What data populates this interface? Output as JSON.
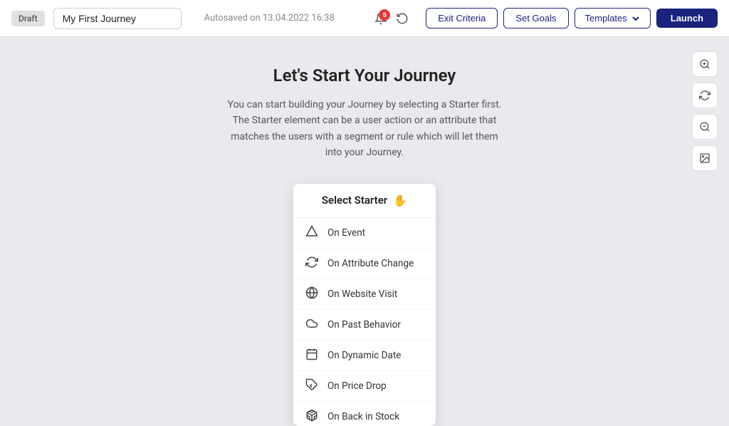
{
  "header": {
    "draft_label": "Draft",
    "journey_name": "My First Journey",
    "autosave_text": "Autosaved on 13.04.2022 16:38",
    "notif_count": "5",
    "exit_criteria_label": "Exit Criteria",
    "set_goals_label": "Set Goals",
    "templates_label": "Templates",
    "launch_label": "Launch"
  },
  "canvas": {
    "title": "Let's Start Your Journey",
    "description": "You can start building your Journey by selecting a Starter first. The Starter element can be a user action or an attribute that matches the users with a segment or rule which will let them into your Journey."
  },
  "starter": {
    "header_label": "Select Starter",
    "items": [
      {
        "id": "on-event",
        "label": "On Event",
        "icon": "triangle"
      },
      {
        "id": "on-attribute-change",
        "label": "On Attribute Change",
        "icon": "refresh"
      },
      {
        "id": "on-website-visit",
        "label": "On Website Visit",
        "icon": "globe"
      },
      {
        "id": "on-past-behavior",
        "label": "On Past Behavior",
        "icon": "cloud"
      },
      {
        "id": "on-dynamic-date",
        "label": "On Dynamic Date",
        "icon": "calendar"
      },
      {
        "id": "on-price-drop",
        "label": "On Price Drop",
        "icon": "tag"
      },
      {
        "id": "on-back-in-stock",
        "label": "On Back in Stock",
        "icon": "box"
      }
    ]
  },
  "toolbar": {
    "zoom_in_icon": "zoom-in",
    "refresh_icon": "refresh",
    "zoom_out_icon": "zoom-out",
    "image_icon": "image"
  }
}
